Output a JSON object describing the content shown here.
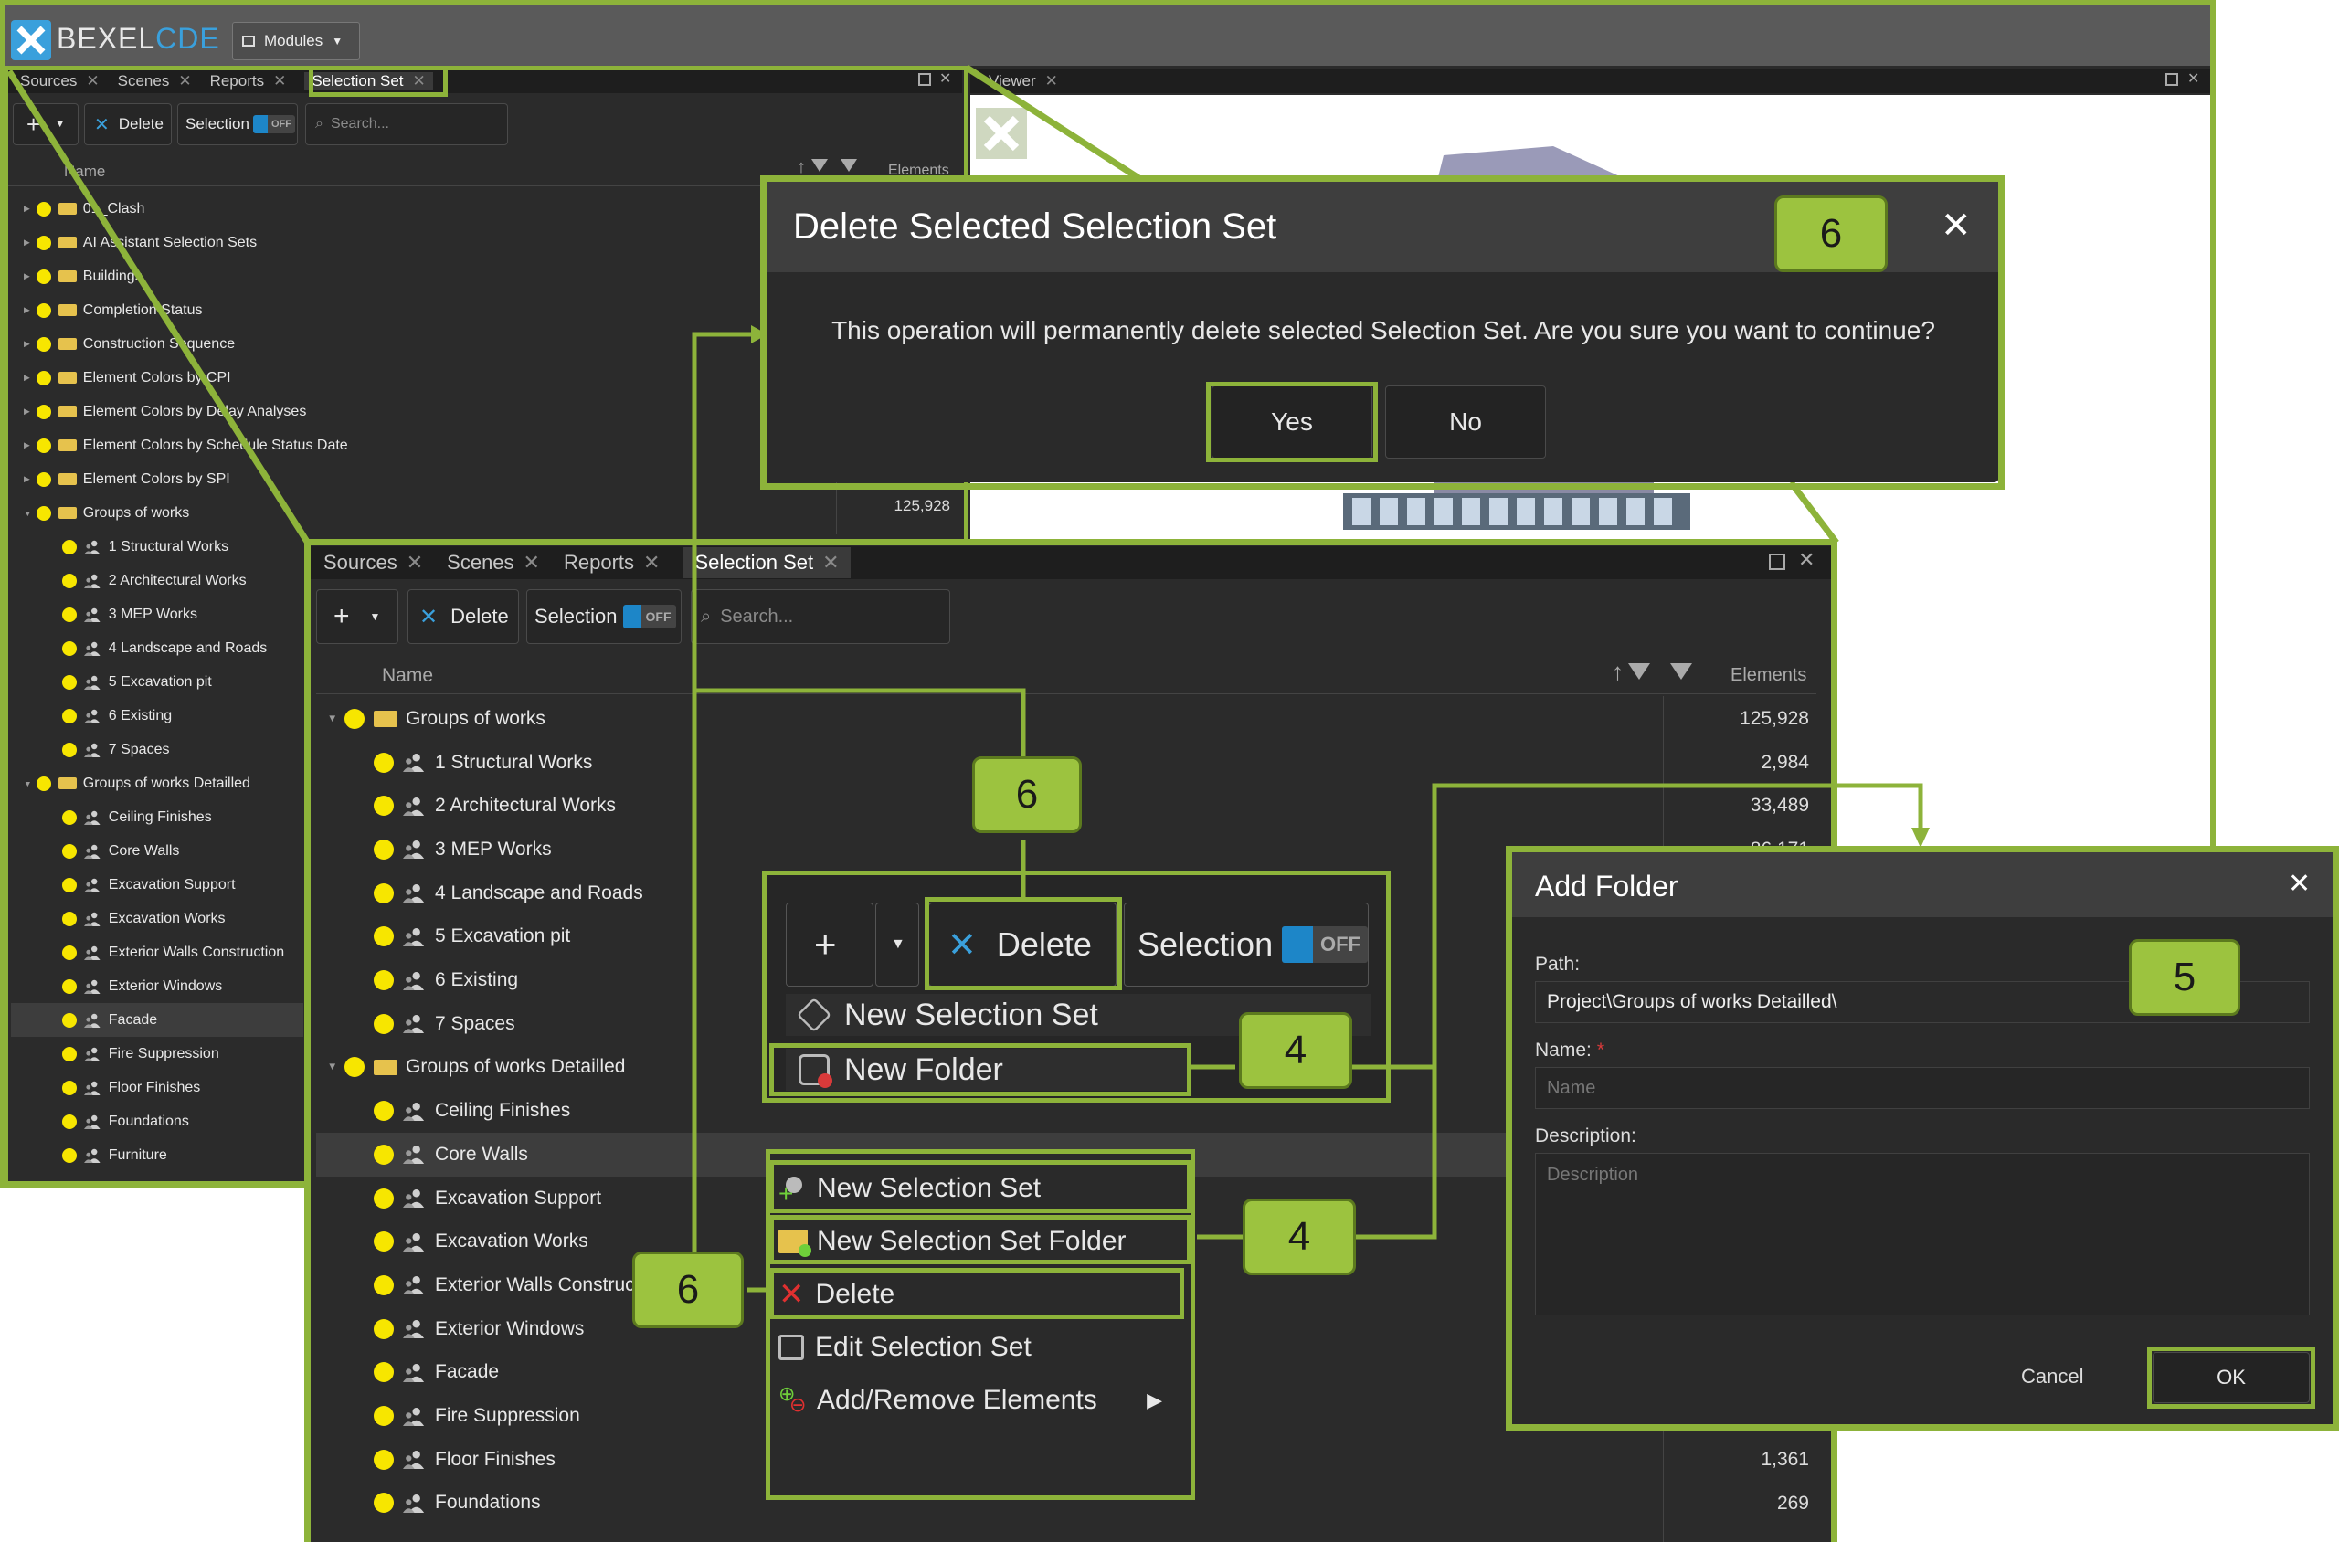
{
  "app": {
    "logo_text": "BEXEL",
    "logo_accent": "CDE",
    "modules_label": "Modules"
  },
  "tabs": [
    "Sources",
    "Scenes",
    "Reports",
    "Selection Set"
  ],
  "viewer_tab": "Viewer",
  "toolbar": {
    "add": "+",
    "delete_label": "Delete",
    "selection_label": "Selection",
    "toggle_off": "OFF",
    "search_placeholder": "Search..."
  },
  "columns": {
    "name": "Name",
    "elements": "Elements"
  },
  "bg_tree": [
    {
      "label": "01_Clash",
      "level": 0,
      "kind": "folder"
    },
    {
      "label": "AI Assistant Selection Sets",
      "level": 0,
      "kind": "folder"
    },
    {
      "label": "Buildings",
      "level": 0,
      "kind": "folder"
    },
    {
      "label": "Completion Status",
      "level": 0,
      "kind": "folder"
    },
    {
      "label": "Construction Sequence",
      "level": 0,
      "kind": "folder"
    },
    {
      "label": "Element Colors by CPI",
      "level": 0,
      "kind": "folder"
    },
    {
      "label": "Element Colors by Delay Analyses",
      "level": 0,
      "kind": "folder"
    },
    {
      "label": "Element Colors by Schedule Status Date",
      "level": 0,
      "kind": "folder"
    },
    {
      "label": "Element Colors by SPI",
      "level": 0,
      "kind": "folder"
    },
    {
      "label": "Groups of works",
      "level": 0,
      "kind": "folder",
      "expanded": true
    },
    {
      "label": "1 Structural Works",
      "level": 1,
      "kind": "set"
    },
    {
      "label": "2 Architectural Works",
      "level": 1,
      "kind": "set"
    },
    {
      "label": "3 MEP Works",
      "level": 1,
      "kind": "set"
    },
    {
      "label": "4 Landscape and Roads",
      "level": 1,
      "kind": "set"
    },
    {
      "label": "5 Excavation pit",
      "level": 1,
      "kind": "set"
    },
    {
      "label": "6 Existing",
      "level": 1,
      "kind": "set"
    },
    {
      "label": "7 Spaces",
      "level": 1,
      "kind": "set"
    },
    {
      "label": "Groups of works Detailled",
      "level": 0,
      "kind": "folder",
      "expanded": true
    },
    {
      "label": "Ceiling Finishes",
      "level": 1,
      "kind": "set"
    },
    {
      "label": "Core Walls",
      "level": 1,
      "kind": "set"
    },
    {
      "label": "Excavation Support",
      "level": 1,
      "kind": "set"
    },
    {
      "label": "Excavation Works",
      "level": 1,
      "kind": "set"
    },
    {
      "label": "Exterior Walls Construction",
      "level": 1,
      "kind": "set"
    },
    {
      "label": "Exterior Windows",
      "level": 1,
      "kind": "set"
    },
    {
      "label": "Facade",
      "level": 1,
      "kind": "set",
      "selected": true
    },
    {
      "label": "Fire Suppression",
      "level": 1,
      "kind": "set"
    },
    {
      "label": "Floor Finishes",
      "level": 1,
      "kind": "set"
    },
    {
      "label": "Foundations",
      "level": 1,
      "kind": "set"
    },
    {
      "label": "Furniture",
      "level": 1,
      "kind": "set"
    }
  ],
  "bg_count": "125,928",
  "fg_tree": [
    {
      "label": "Groups of works",
      "level": 0,
      "kind": "folder",
      "count": "125,928"
    },
    {
      "label": "1 Structural Works",
      "level": 1,
      "kind": "set",
      "count": "2,984"
    },
    {
      "label": "2 Architectural Works",
      "level": 1,
      "kind": "set",
      "count": "33,489"
    },
    {
      "label": "3 MEP Works",
      "level": 1,
      "kind": "set",
      "count": "86,171"
    },
    {
      "label": "4 Landscape and Roads",
      "level": 1,
      "kind": "set",
      "count": ""
    },
    {
      "label": "5 Excavation pit",
      "level": 1,
      "kind": "set",
      "count": ""
    },
    {
      "label": "6 Existing",
      "level": 1,
      "kind": "set",
      "count": ""
    },
    {
      "label": "7 Spaces",
      "level": 1,
      "kind": "set",
      "count": ""
    },
    {
      "label": "Groups of works Detailled",
      "level": 0,
      "kind": "folder",
      "count": ""
    },
    {
      "label": "Ceiling Finishes",
      "level": 1,
      "kind": "set",
      "count": ""
    },
    {
      "label": "Core Walls",
      "level": 1,
      "kind": "set",
      "count": "",
      "selected": true
    },
    {
      "label": "Excavation Support",
      "level": 1,
      "kind": "set",
      "count": ""
    },
    {
      "label": "Excavation Works",
      "level": 1,
      "kind": "set",
      "count": ""
    },
    {
      "label": "Exterior Walls Construction",
      "level": 1,
      "kind": "set",
      "count": ""
    },
    {
      "label": "Exterior Windows",
      "level": 1,
      "kind": "set",
      "count": ""
    },
    {
      "label": "Facade",
      "level": 1,
      "kind": "set",
      "count": ""
    },
    {
      "label": "Fire Suppression",
      "level": 1,
      "kind": "set",
      "count": ""
    },
    {
      "label": "Floor Finishes",
      "level": 1,
      "kind": "set",
      "count": "1,361"
    },
    {
      "label": "Foundations",
      "level": 1,
      "kind": "set",
      "count": "269"
    }
  ],
  "dropdown": {
    "new_selection_set": "New Selection Set",
    "new_folder": "New Folder"
  },
  "context_menu": {
    "new_selection_set": "New Selection Set",
    "new_selection_set_folder": "New Selection Set Folder",
    "delete": "Delete",
    "edit_selection_set": "Edit Selection Set",
    "add_remove_elements": "Add/Remove Elements"
  },
  "delete_dialog": {
    "title": "Delete Selected Selection Set",
    "message": "This operation will permanently delete selected Selection Set. Are you sure you want to continue?",
    "yes": "Yes",
    "no": "No"
  },
  "add_folder_dialog": {
    "title": "Add Folder",
    "path_label": "Path:",
    "path_value": "Project\\Groups of works Detailled\\",
    "name_label": "Name:",
    "name_placeholder": "Name",
    "description_label": "Description:",
    "description_placeholder": "Description",
    "cancel": "Cancel",
    "ok": "OK"
  },
  "callouts": {
    "dialog_step": "6",
    "toolbar_delete_step": "6",
    "new_folder_step": "4",
    "context_new_folder_step": "4",
    "context_delete_step": "6",
    "add_folder_step": "5"
  },
  "colors": {
    "highlight": "#8db33a",
    "callout_fill": "#9cc33f",
    "dark_panel": "#2b2b2b",
    "toggle_blue": "#1d86c8",
    "set_dot": "#f7e600"
  }
}
